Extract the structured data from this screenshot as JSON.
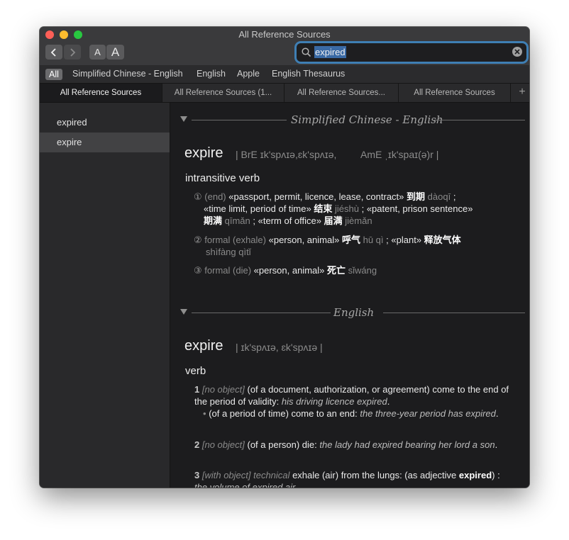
{
  "window": {
    "title": "All Reference Sources"
  },
  "toolbar": {
    "font_smaller": "A",
    "font_larger": "A"
  },
  "search": {
    "value": "expired"
  },
  "sources": [
    "All",
    "Simplified Chinese - English",
    "English",
    "Apple",
    "English Thesaurus"
  ],
  "tabs": [
    "All Reference Sources",
    "All Reference Sources (1...",
    "All Reference Sources...",
    "All Reference Sources"
  ],
  "tab_add": "+",
  "sidebar": {
    "items": [
      "expired",
      "expire"
    ]
  },
  "chinese": {
    "section_title": "Simplified Chinese - English",
    "headword": "expire",
    "pron_bre": "| BrE ɪk'spʌɪə,ɛk'spʌɪə,",
    "pron_ame": "AmE ˌɪk'spaɪ(ə)r |",
    "pos": "intransitive verb",
    "s1": {
      "num": "①",
      "label": "(end)",
      "a": "«passport, permit, licence, lease, contract»",
      "a_zh": "到期",
      "a_py": "dàoqī",
      "sep1": ";",
      "b": "«time limit, period of time»",
      "b_zh": "结束",
      "b_py": "jiéshù",
      "sep2": "; «patent, prison sentence»",
      "c_zh": "期满",
      "c_py": "qīmǎn",
      "sep3": "; «term of office»",
      "d_zh": "届满",
      "d_py": "jièmǎn"
    },
    "s2": {
      "num": "②",
      "label": "formal (exhale)",
      "a": "«person, animal»",
      "a_zh": "呼气",
      "a_py": "hū qì",
      "sep": "; «plant»",
      "b_zh": "释放气体",
      "b_py": "shìfàng qìtǐ"
    },
    "s3": {
      "num": "③",
      "label": "formal (die)",
      "a": "«person, animal»",
      "a_zh": "死亡",
      "a_py": "sǐwáng"
    }
  },
  "english": {
    "section_title": "English",
    "headword": "expire",
    "pron": "| ɪk'spʌɪə, ɛk'spʌɪə |",
    "pos": "verb",
    "d1": {
      "num": "1",
      "label": "[no object]",
      "text": "(of a document, authorization, or agreement) come to the end of the period of validity:",
      "example": "his driving licence expired",
      "end": ".",
      "sub_text": "(of a period of time) come to an end:",
      "sub_example": "the three-year period has expired",
      "sub_end": "."
    },
    "d2": {
      "num": "2",
      "label": "[no object]",
      "text": "(of a person) die:",
      "example": "the lady had expired bearing her lord a son",
      "end": "."
    },
    "d3": {
      "num": "3",
      "label": "[with object] technical",
      "text": "exhale (air) from the lungs: (as adjective",
      "bold": "expired",
      "end": ") :",
      "example": "the volume of expired air"
    }
  }
}
